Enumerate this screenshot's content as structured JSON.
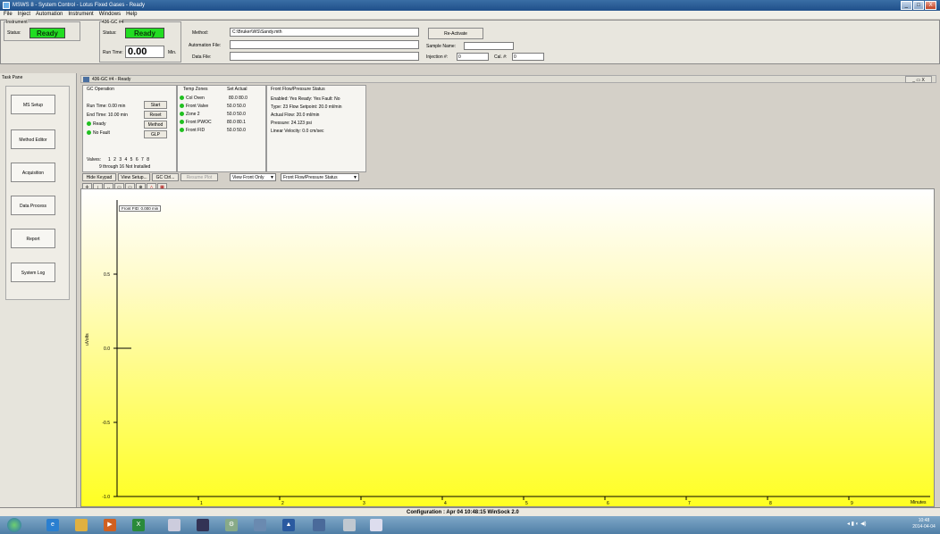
{
  "window": {
    "title": "MSWS 8 - System Control - Lotus Fixed Gases - Ready",
    "min": "_",
    "max": "□",
    "close": "X"
  },
  "menu": [
    "File",
    "Inject",
    "Automation",
    "Instrument",
    "Windows",
    "Help"
  ],
  "instrument": {
    "group_label": "Instrument",
    "status_label": "Status:",
    "status_value": "Ready"
  },
  "gc": {
    "group_label": "436-GC #4",
    "status_label": "Status:",
    "status_value": "Ready",
    "runtime_label": "Run Time:",
    "runtime_value": "0.00",
    "runtime_unit": "Min."
  },
  "method": {
    "method_label": "Method:",
    "method_value": "C:\\Bruker\\WS\\Sandy.mth",
    "automation_label": "Automation File:",
    "automation_value": "",
    "datafile_label": "Data File:",
    "datafile_value": ""
  },
  "reactivate_label": "Re-Activate",
  "sample": {
    "name_label": "Sample Name:",
    "name_value": "",
    "injection_label": "Injection #:",
    "injection_value": "0",
    "cal_label": "Cal. #:",
    "cal_value": "0"
  },
  "task_pane": {
    "title": "Task Pane",
    "buttons": [
      "MS Setup",
      "Method Editor",
      "Acquisition",
      "Data Process",
      "Report",
      "System Log"
    ]
  },
  "child": {
    "title": "436-GC #4 - Ready",
    "win_btns": "_ ▭ X"
  },
  "gc_operation": {
    "title": "GC Operation",
    "runtime": "Run Time:   0.00 min",
    "endtime": "End Time:  10.00 min",
    "ready": "Ready",
    "nofault": "No Fault",
    "btn_start": "Start",
    "btn_reset": "Reset",
    "btn_method": "Method",
    "btn_glp": "GLP",
    "valves_label": "Valves:",
    "valves_nums": "1 2 3 4 5 6 7 8",
    "valves_note": "9 through 16 Not Installed"
  },
  "temp_zones": {
    "title": "Temp Zones",
    "header": "Set  Actual",
    "rows": [
      {
        "name": "Col Oven",
        "vals": "80.0   80.0"
      },
      {
        "name": "Front Valve",
        "vals": "50.0   50.0"
      },
      {
        "name": "Zone 2",
        "vals": "50.0   50.0"
      },
      {
        "name": "Front PWOC",
        "vals": "80.0   80.1"
      },
      {
        "name": "Front FID",
        "vals": "50.0   50.0"
      }
    ]
  },
  "flow_status": {
    "title": "Front Flow/Pressure Status",
    "lines": [
      "Enabled: Yes   Ready: Yes   Fault: No",
      "Type: 23   Flow Setpoint: 20.0 ml/min",
      "Actual Flow: 20.0 ml/min",
      "Pressure: 24.123 psi",
      "Linear Velocity: 0.0 cm/sec"
    ]
  },
  "toolbar2": {
    "hide_keypad": "Hide Keypad",
    "view_setup": "View Setup...",
    "gc_ctrl": "GC Ctrl...",
    "resume": "Resume Plot",
    "view_front": "View Front Only",
    "front_flow": "Front Flow/Pressure Status"
  },
  "plot_tools": [
    "✛",
    "↕",
    "↔",
    "▭",
    "▭",
    "⊕",
    "△",
    "▦"
  ],
  "status_bar": {
    "text": "Configuration : Apr 04 10:48:15  WinSock 2.0"
  },
  "taskbar": {
    "clock_time": "10:48",
    "clock_date": "2014-04-04"
  },
  "chart_data": {
    "type": "line",
    "title": "",
    "trace_label": "Front FID: 0.000 min",
    "xlabel": "Minutes",
    "ylabel": "uVolts",
    "xlim": [
      0,
      10
    ],
    "ylim": [
      -1.0,
      1.0
    ],
    "x_ticks": [
      1,
      2,
      3,
      4,
      5,
      6,
      7,
      8,
      9
    ],
    "y_ticks": [
      "0.5",
      "0.0",
      "-0.5",
      "-1.0"
    ],
    "series": [
      {
        "values": [
          0.0
        ],
        "x": [
          0.0
        ]
      }
    ]
  }
}
